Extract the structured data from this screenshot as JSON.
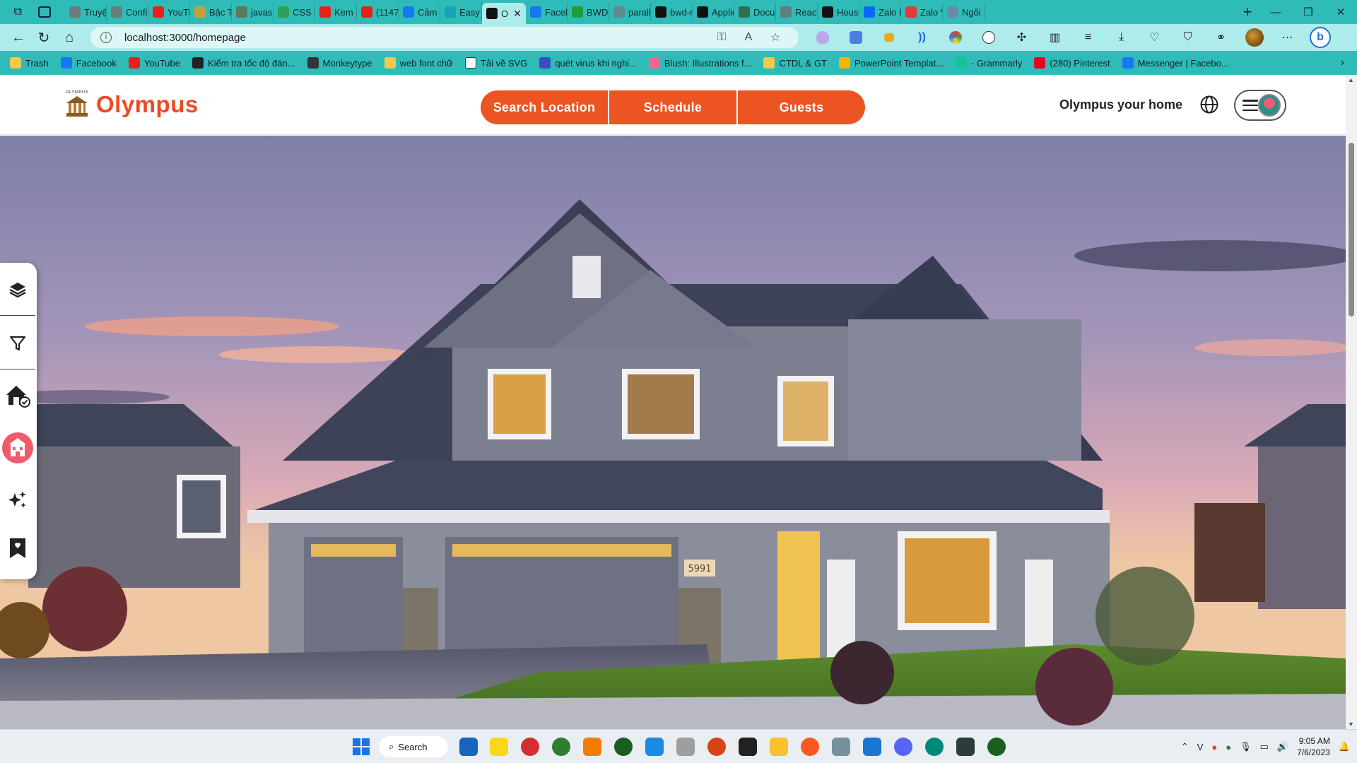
{
  "browser": {
    "tabs": [
      {
        "label": "Truyệ",
        "icon": "ghost-icon",
        "color": "#6c7a7a"
      },
      {
        "label": "Config",
        "icon": "gear-icon",
        "color": "#6c7a7a"
      },
      {
        "label": "YouTu",
        "icon": "youtube-icon",
        "color": "#e62117"
      },
      {
        "label": "Bậc Tỉ",
        "icon": "n-icon",
        "color": "#c3a23a"
      },
      {
        "label": "javasc",
        "icon": "script-icon",
        "color": "#5a7a5a"
      },
      {
        "label": "CSS w",
        "icon": "w3-icon",
        "color": "#2e9e58"
      },
      {
        "label": "Kem ß",
        "icon": "youtube-icon",
        "color": "#e62117"
      },
      {
        "label": "(1147",
        "icon": "youtube-icon",
        "color": "#e62117"
      },
      {
        "label": "Cảm ł",
        "icon": "facebook-icon",
        "color": "#1877f2"
      },
      {
        "label": "Easy F",
        "icon": "easy-icon",
        "color": "#17a2b8"
      },
      {
        "label": "O",
        "icon": "triangle-icon",
        "color": "#111111",
        "active": true
      },
      {
        "label": "Faceb",
        "icon": "facebook-icon",
        "color": "#1877f2"
      },
      {
        "label": "BWD",
        "icon": "plus-icon",
        "color": "#1e9e3e"
      },
      {
        "label": "parall",
        "icon": "g-icon",
        "color": "#5e8c8c"
      },
      {
        "label": "bwd-r",
        "icon": "triangle-icon",
        "color": "#111111"
      },
      {
        "label": "Applic",
        "icon": "triangle-icon",
        "color": "#111111"
      },
      {
        "label": "Docu",
        "icon": "flag-icon",
        "color": "#2f6f4f"
      },
      {
        "label": "React",
        "icon": "dot-icon",
        "color": "#5f7f7f"
      },
      {
        "label": "Hous",
        "icon": "house-icon",
        "color": "#111111"
      },
      {
        "label": "Zalo F",
        "icon": "zalo-icon",
        "color": "#0a68ff"
      },
      {
        "label": "Zalo V",
        "icon": "zalo-icon",
        "color": "#e53935"
      },
      {
        "label": "Ngôi i",
        "icon": "doc-icon",
        "color": "#6a8aaa"
      }
    ],
    "url": "localhost:3000/homepage",
    "bookmarks": [
      {
        "label": "Trash",
        "icon": "folder-icon",
        "color": "#f2c94c"
      },
      {
        "label": "Facebook",
        "icon": "facebook-icon",
        "color": "#1877f2"
      },
      {
        "label": "YouTube",
        "icon": "youtube-icon",
        "color": "#e62117"
      },
      {
        "label": "Kiểm tra tốc độ đán...",
        "icon": "keyboard-icon",
        "color": "#222222"
      },
      {
        "label": "Monkeytype",
        "icon": "monkey-icon",
        "color": "#323437"
      },
      {
        "label": "web font chữ",
        "icon": "folder-icon",
        "color": "#f2c94c"
      },
      {
        "label": "Tải về SVG",
        "icon": "file-icon",
        "color": "#ffffff"
      },
      {
        "label": "quét virus khi nghi...",
        "icon": "sigma-icon",
        "color": "#3b4cc0"
      },
      {
        "label": "Blush: Illustrations f...",
        "icon": "blush-icon",
        "color": "#f06a8f"
      },
      {
        "label": "CTDL & GT",
        "icon": "folder-icon",
        "color": "#f2c94c"
      },
      {
        "label": "PowerPoint Templat...",
        "icon": "drive-icon",
        "color": "#f4b400"
      },
      {
        "label": "- Grammarly",
        "icon": "grammarly-icon",
        "color": "#15c39a"
      },
      {
        "label": "(280) Pinterest",
        "icon": "pinterest-icon",
        "color": "#e60023"
      },
      {
        "label": "Messenger | Facebo...",
        "icon": "facebook-icon",
        "color": "#1877f2"
      }
    ]
  },
  "header": {
    "logo_text": "Olympus",
    "logo_small": "OLYMPUS",
    "nav": [
      "Search Location",
      "Schedule",
      "Guests"
    ],
    "tagline": "Olympus your home"
  },
  "colors": {
    "brand": "#ec4a26",
    "pill": "#ed5424",
    "chrome": "#2fbcb9"
  },
  "hero": {
    "house_number": "5991"
  },
  "sidebar": [
    {
      "icon": "layers-icon"
    },
    {
      "icon": "filter-icon"
    },
    {
      "icon": "home-check-icon"
    },
    {
      "icon": "building-icon",
      "active": true
    },
    {
      "icon": "sparkle-icon"
    },
    {
      "icon": "bookmark-heart-icon"
    }
  ],
  "taskbar": {
    "search_label": "Search",
    "time": "9:05 AM",
    "date": "7/6/2023"
  }
}
